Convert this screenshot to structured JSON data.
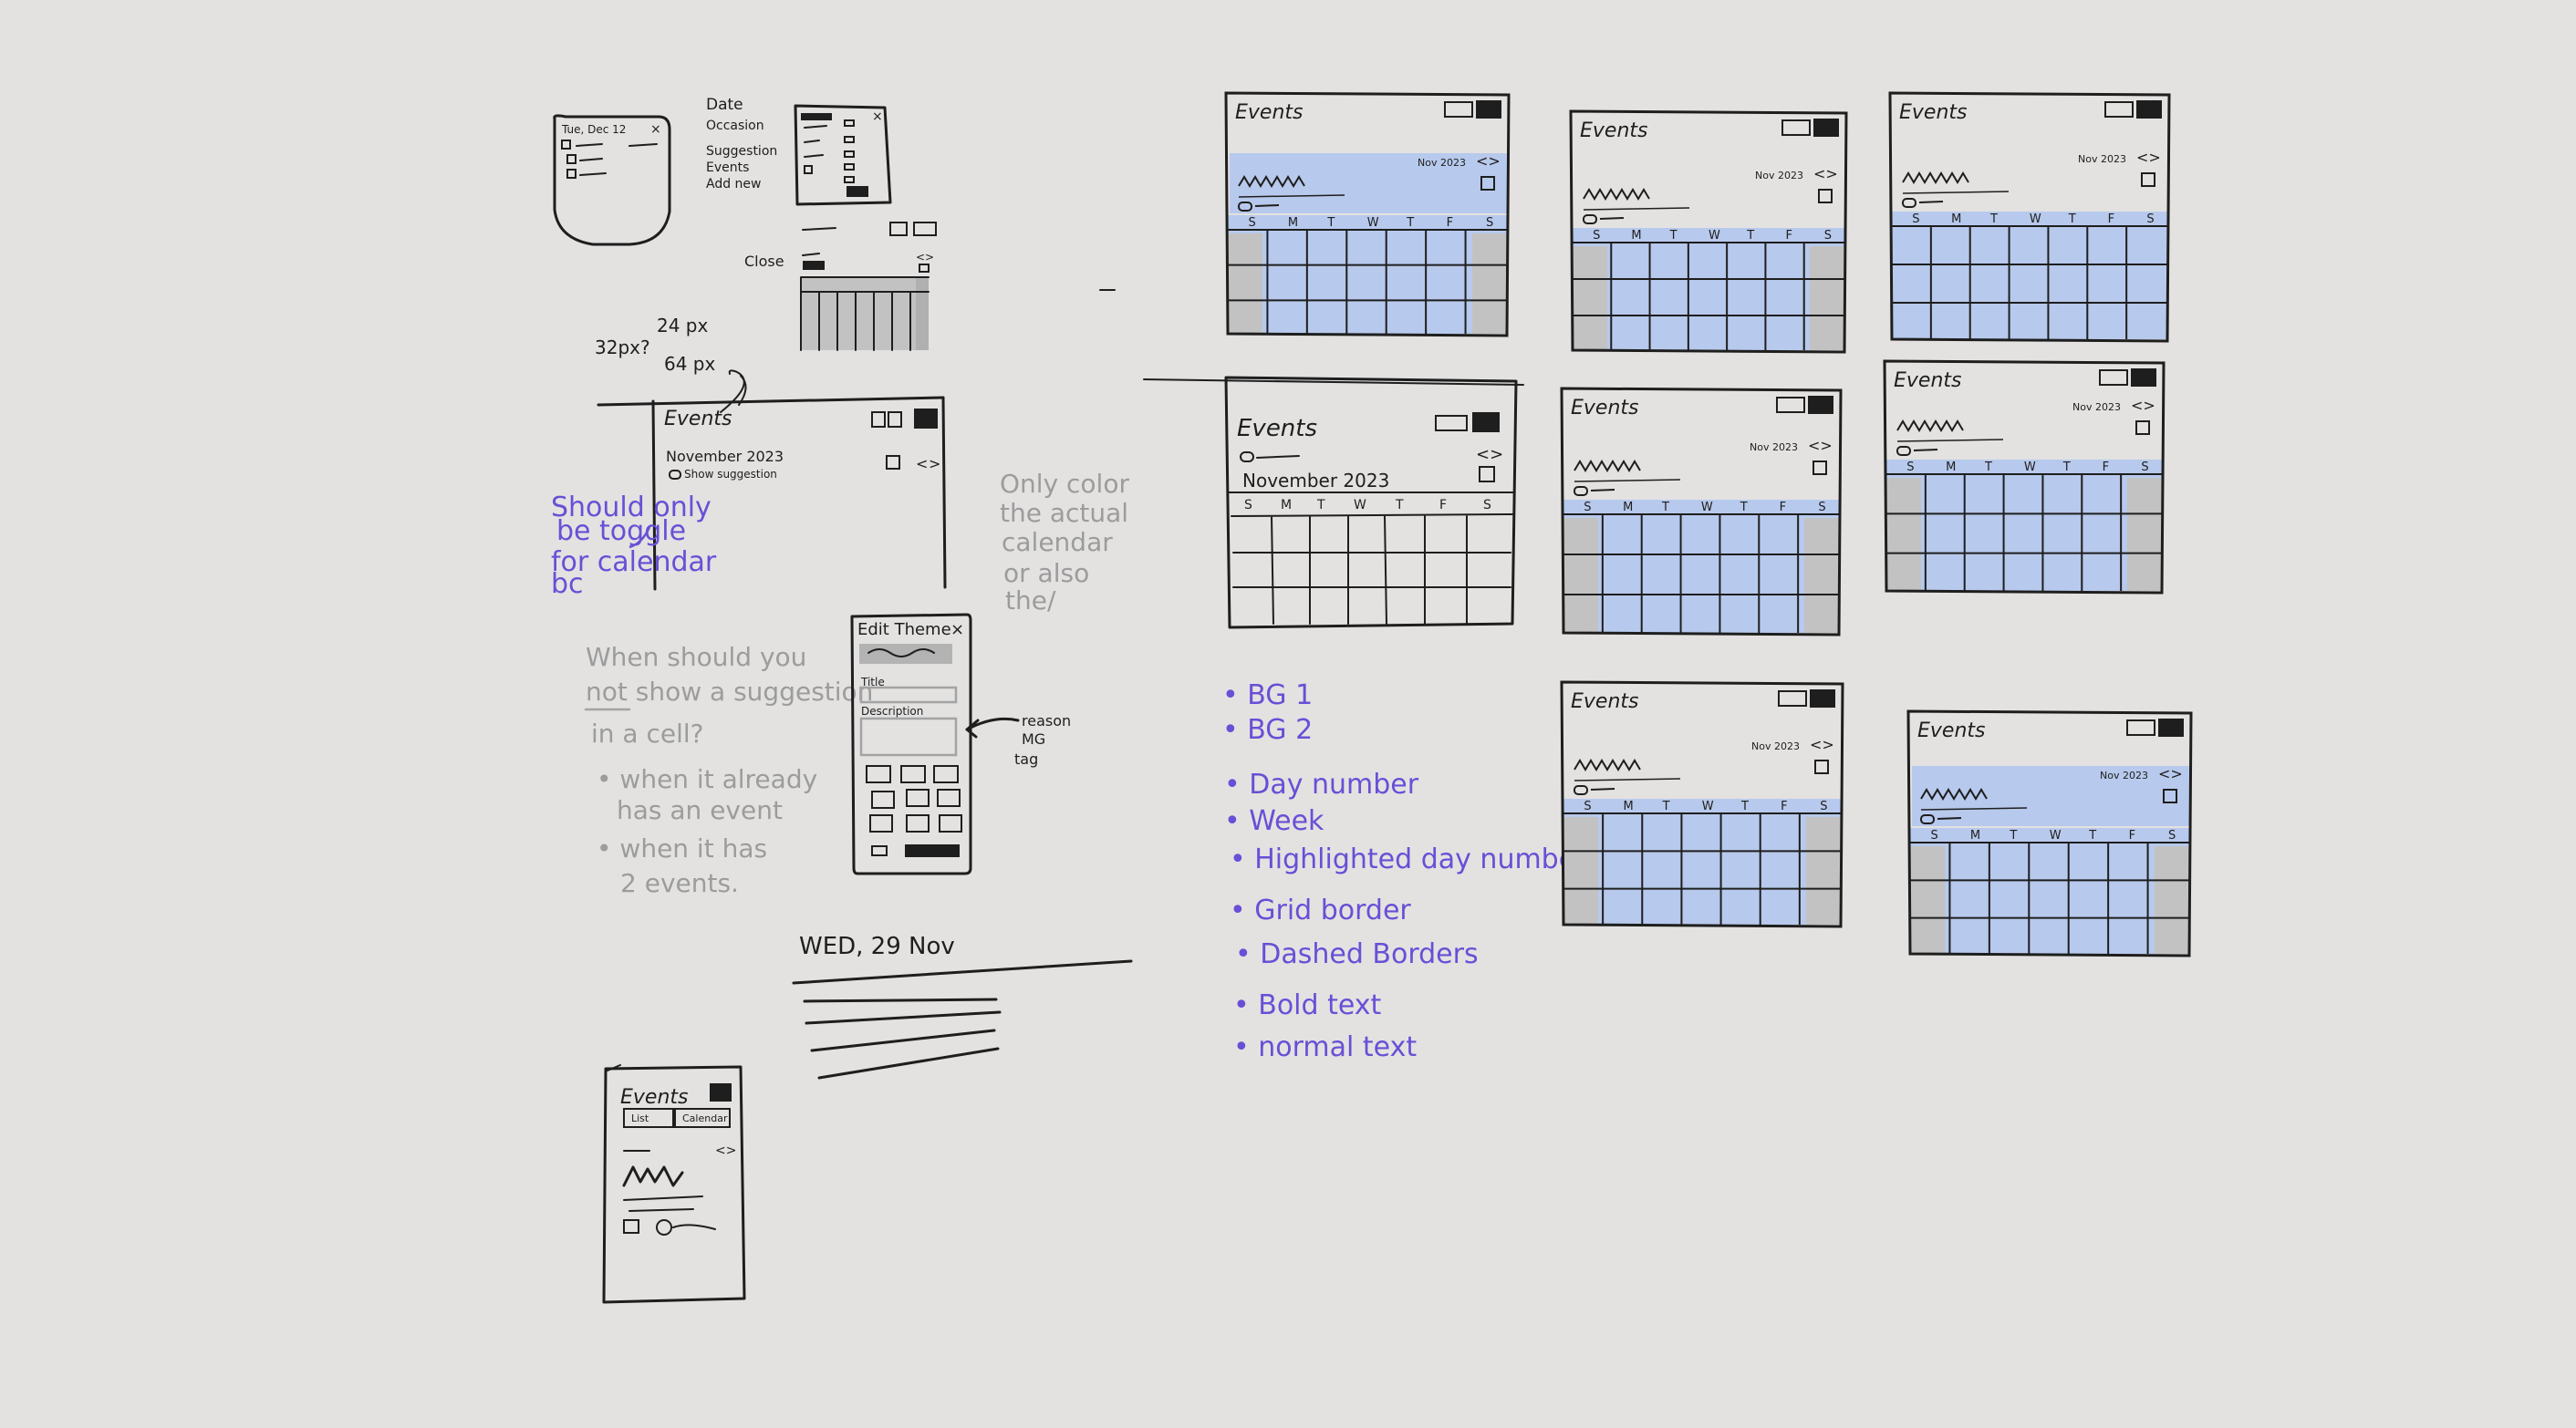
{
  "sketch": {
    "top_left": {
      "date_label": "Tue, Dec 12",
      "menu_items": [
        "Date",
        "Occasion",
        "Suggestion",
        "Events",
        "Add new"
      ],
      "close_label": "Close",
      "px_note_a": "32px?",
      "px_note_b": "24 px",
      "px_note_c": "64 px"
    },
    "events_header": {
      "title": "Events",
      "month": "November 2023",
      "toggle_label": "Show suggestion",
      "nav_prev": "<",
      "nav_next": ">"
    },
    "violet_note": [
      "Should only",
      "be toggle",
      "for calendar",
      "bc"
    ],
    "grey_note": [
      "Only color",
      "the actual",
      "calendar",
      "or also",
      "the/"
    ],
    "question_note": [
      "When should you",
      "not show a suggestion",
      "in a cell?",
      "• when it already",
      "has an event",
      "• when it has",
      "2 events."
    ],
    "edit_theme": {
      "title": "Edit Theme",
      "close_icon": "×",
      "title_field": "Title",
      "description_field": "Description",
      "arrow_note": [
        "reason",
        "MG",
        "tag"
      ]
    },
    "day_header": "WED, 29 Nov",
    "mobile": {
      "title": "Events",
      "list_tab": "List",
      "calendar_tab": "Calendar"
    },
    "big_calendar": {
      "title": "Events",
      "month": "November 2023",
      "weekdays": [
        "S",
        "M",
        "T",
        "W",
        "T",
        "F",
        "S"
      ]
    },
    "color_list": [
      "• BG 1",
      "• BG 2",
      "• Day number",
      "• Week",
      "• Highlighted day number",
      "• Grid border",
      "• Dashed Borders",
      "• Bold text",
      "• normal text"
    ],
    "variant_title": "Events",
    "variant_month": "Nov 2023",
    "variant_weekdays": [
      "S",
      "M",
      "T",
      "W",
      "T",
      "F",
      "S"
    ],
    "colors": {
      "ink": "#1e1e1e",
      "blue_fill": "#b7c9ec",
      "grey_fill": "#c2c2c2",
      "violet": "#6a4fd6",
      "pencil": "#a3a3a3",
      "board": "#e3e2e1"
    }
  }
}
